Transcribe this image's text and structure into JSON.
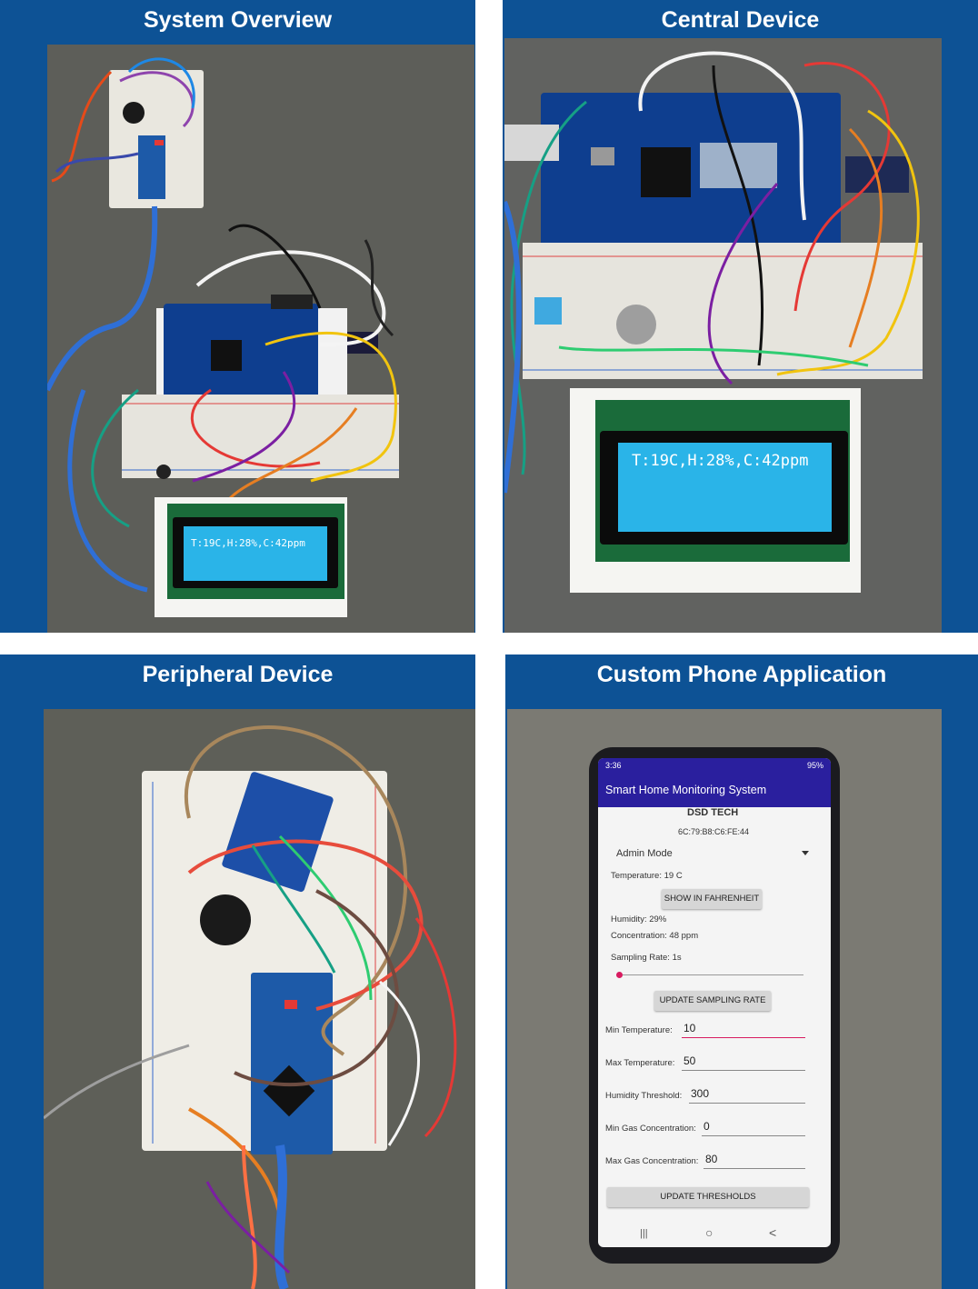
{
  "panels": [
    {
      "title": "System Overview"
    },
    {
      "title": "Central Device"
    },
    {
      "title": "Peripheral Device"
    },
    {
      "title": "Custom Phone Application"
    }
  ],
  "lcd": {
    "overview": "T:19C,H:28%,C:42ppm",
    "central": "T:19C,H:28%,C:42ppm"
  },
  "phone": {
    "status_time": "3:36",
    "status_battery": "95%",
    "app_title": "Smart Home Monitoring System",
    "device_name": "DSD TECH",
    "device_mac": "6C:79:B8:C6:FE:44",
    "mode_label": "Admin Mode",
    "temperature": "Temperature: 19 C",
    "show_f_button": "SHOW IN FAHRENHEIT",
    "humidity": "Humidity: 29%",
    "concentration": "Concentration: 48 ppm",
    "sampling_rate": "Sampling Rate: 1s",
    "sampling_slider_fraction": 0.0,
    "update_sampling_button": "UPDATE SAMPLING RATE",
    "fields": [
      {
        "label": "Min Temperature:",
        "value": "10"
      },
      {
        "label": "Max Temperature:",
        "value": "50"
      },
      {
        "label": "Humidity Threshold:",
        "value": "300"
      },
      {
        "label": "Min Gas Concentration:",
        "value": "0"
      },
      {
        "label": "Max Gas Concentration:",
        "value": "80"
      }
    ],
    "update_thresholds_button": "UPDATE THRESHOLDS",
    "nav": {
      "recent": "|||",
      "home": "○",
      "back": "<"
    }
  },
  "colors": {
    "panel_blue": "#0d5295",
    "lcd_blue": "#2ab4e8",
    "app_bar": "#2a1f9e",
    "accent_pink": "#d81b60"
  }
}
